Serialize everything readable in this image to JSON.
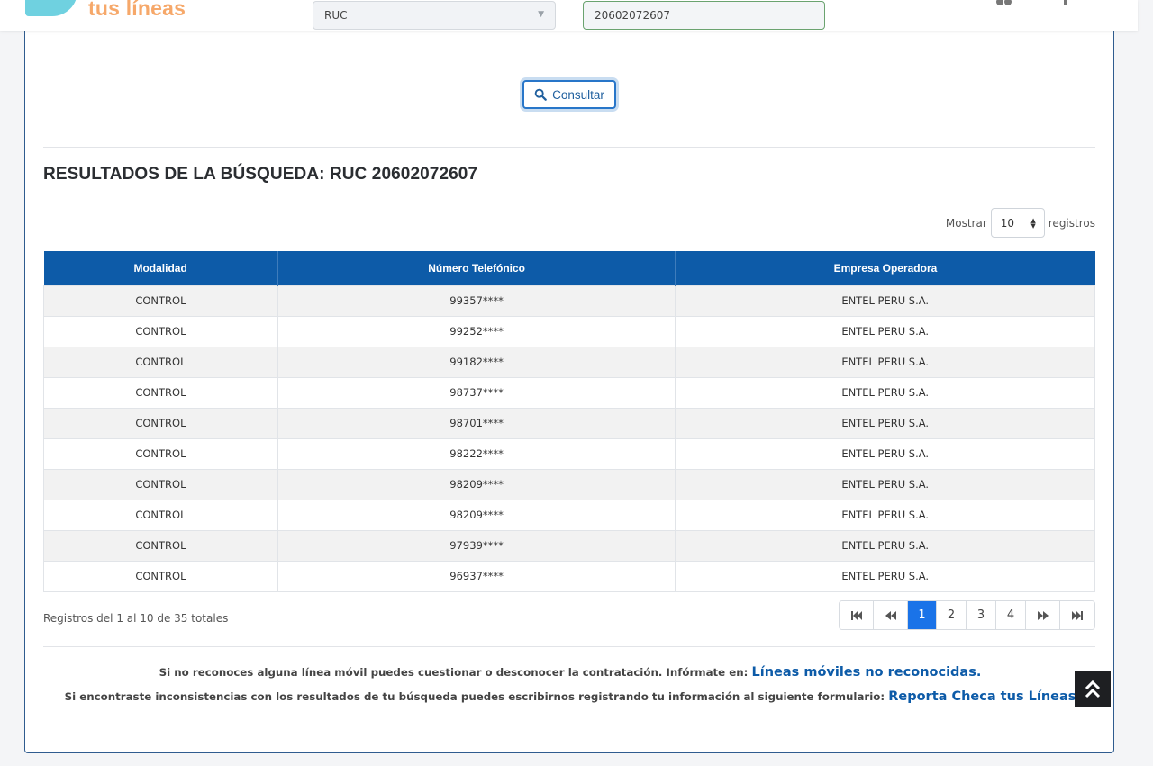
{
  "header": {
    "logo_text": "tus líneas",
    "doc_type_selected": "RUC",
    "doc_number_value": "20602072607"
  },
  "search": {
    "consult_label": "Consultar"
  },
  "results": {
    "title": "RESULTADOS DE LA BÚSQUEDA: RUC 20602072607",
    "show_label": "Mostrar",
    "show_value": "10",
    "records_label": "registros",
    "columns": [
      "Modalidad",
      "Número Telefónico",
      "Empresa Operadora"
    ],
    "rows": [
      [
        "CONTROL",
        "99357****",
        "ENTEL PERU S.A."
      ],
      [
        "CONTROL",
        "99252****",
        "ENTEL PERU S.A."
      ],
      [
        "CONTROL",
        "99182****",
        "ENTEL PERU S.A."
      ],
      [
        "CONTROL",
        "98737****",
        "ENTEL PERU S.A."
      ],
      [
        "CONTROL",
        "98701****",
        "ENTEL PERU S.A."
      ],
      [
        "CONTROL",
        "98222****",
        "ENTEL PERU S.A."
      ],
      [
        "CONTROL",
        "98209****",
        "ENTEL PERU S.A."
      ],
      [
        "CONTROL",
        "98209****",
        "ENTEL PERU S.A."
      ],
      [
        "CONTROL",
        "97939****",
        "ENTEL PERU S.A."
      ],
      [
        "CONTROL",
        "96937****",
        "ENTEL PERU S.A."
      ]
    ],
    "summary": "Registros del 1 al 10 de 35 totales"
  },
  "pagination": {
    "pages": [
      "1",
      "2",
      "3",
      "4"
    ],
    "active_page": "1"
  },
  "info": {
    "line1_text": "Si no reconoces alguna línea móvil puedes cuestionar o desconocer la contratación. Infórmate en:",
    "line1_link": "Líneas móviles no reconocidas.",
    "line2_text": "Si encontraste inconsistencias con los resultados de tu búsqueda puedes escribirnos registrando tu información al siguiente formulario:",
    "line2_link": "Reporta Checa tus Líneas"
  },
  "colors": {
    "primary_blue": "#0d5ba8",
    "active_page": "#1a73e8",
    "logo_orange": "#f6a86a",
    "logo_cyan": "#6fd1e0"
  }
}
